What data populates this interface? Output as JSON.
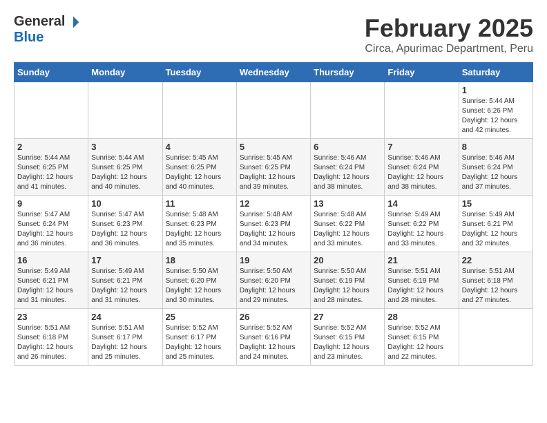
{
  "header": {
    "logo_general": "General",
    "logo_blue": "Blue",
    "title": "February 2025",
    "subtitle": "Circa, Apurimac Department, Peru"
  },
  "days_of_week": [
    "Sunday",
    "Monday",
    "Tuesday",
    "Wednesday",
    "Thursday",
    "Friday",
    "Saturday"
  ],
  "weeks": [
    [
      {
        "day": "",
        "info": ""
      },
      {
        "day": "",
        "info": ""
      },
      {
        "day": "",
        "info": ""
      },
      {
        "day": "",
        "info": ""
      },
      {
        "day": "",
        "info": ""
      },
      {
        "day": "",
        "info": ""
      },
      {
        "day": "1",
        "info": "Sunrise: 5:44 AM\nSunset: 6:26 PM\nDaylight: 12 hours\nand 42 minutes."
      }
    ],
    [
      {
        "day": "2",
        "info": "Sunrise: 5:44 AM\nSunset: 6:25 PM\nDaylight: 12 hours\nand 41 minutes."
      },
      {
        "day": "3",
        "info": "Sunrise: 5:44 AM\nSunset: 6:25 PM\nDaylight: 12 hours\nand 40 minutes."
      },
      {
        "day": "4",
        "info": "Sunrise: 5:45 AM\nSunset: 6:25 PM\nDaylight: 12 hours\nand 40 minutes."
      },
      {
        "day": "5",
        "info": "Sunrise: 5:45 AM\nSunset: 6:25 PM\nDaylight: 12 hours\nand 39 minutes."
      },
      {
        "day": "6",
        "info": "Sunrise: 5:46 AM\nSunset: 6:24 PM\nDaylight: 12 hours\nand 38 minutes."
      },
      {
        "day": "7",
        "info": "Sunrise: 5:46 AM\nSunset: 6:24 PM\nDaylight: 12 hours\nand 38 minutes."
      },
      {
        "day": "8",
        "info": "Sunrise: 5:46 AM\nSunset: 6:24 PM\nDaylight: 12 hours\nand 37 minutes."
      }
    ],
    [
      {
        "day": "9",
        "info": "Sunrise: 5:47 AM\nSunset: 6:24 PM\nDaylight: 12 hours\nand 36 minutes."
      },
      {
        "day": "10",
        "info": "Sunrise: 5:47 AM\nSunset: 6:23 PM\nDaylight: 12 hours\nand 36 minutes."
      },
      {
        "day": "11",
        "info": "Sunrise: 5:48 AM\nSunset: 6:23 PM\nDaylight: 12 hours\nand 35 minutes."
      },
      {
        "day": "12",
        "info": "Sunrise: 5:48 AM\nSunset: 6:23 PM\nDaylight: 12 hours\nand 34 minutes."
      },
      {
        "day": "13",
        "info": "Sunrise: 5:48 AM\nSunset: 6:22 PM\nDaylight: 12 hours\nand 33 minutes."
      },
      {
        "day": "14",
        "info": "Sunrise: 5:49 AM\nSunset: 6:22 PM\nDaylight: 12 hours\nand 33 minutes."
      },
      {
        "day": "15",
        "info": "Sunrise: 5:49 AM\nSunset: 6:21 PM\nDaylight: 12 hours\nand 32 minutes."
      }
    ],
    [
      {
        "day": "16",
        "info": "Sunrise: 5:49 AM\nSunset: 6:21 PM\nDaylight: 12 hours\nand 31 minutes."
      },
      {
        "day": "17",
        "info": "Sunrise: 5:49 AM\nSunset: 6:21 PM\nDaylight: 12 hours\nand 31 minutes."
      },
      {
        "day": "18",
        "info": "Sunrise: 5:50 AM\nSunset: 6:20 PM\nDaylight: 12 hours\nand 30 minutes."
      },
      {
        "day": "19",
        "info": "Sunrise: 5:50 AM\nSunset: 6:20 PM\nDaylight: 12 hours\nand 29 minutes."
      },
      {
        "day": "20",
        "info": "Sunrise: 5:50 AM\nSunset: 6:19 PM\nDaylight: 12 hours\nand 28 minutes."
      },
      {
        "day": "21",
        "info": "Sunrise: 5:51 AM\nSunset: 6:19 PM\nDaylight: 12 hours\nand 28 minutes."
      },
      {
        "day": "22",
        "info": "Sunrise: 5:51 AM\nSunset: 6:18 PM\nDaylight: 12 hours\nand 27 minutes."
      }
    ],
    [
      {
        "day": "23",
        "info": "Sunrise: 5:51 AM\nSunset: 6:18 PM\nDaylight: 12 hours\nand 26 minutes."
      },
      {
        "day": "24",
        "info": "Sunrise: 5:51 AM\nSunset: 6:17 PM\nDaylight: 12 hours\nand 25 minutes."
      },
      {
        "day": "25",
        "info": "Sunrise: 5:52 AM\nSunset: 6:17 PM\nDaylight: 12 hours\nand 25 minutes."
      },
      {
        "day": "26",
        "info": "Sunrise: 5:52 AM\nSunset: 6:16 PM\nDaylight: 12 hours\nand 24 minutes."
      },
      {
        "day": "27",
        "info": "Sunrise: 5:52 AM\nSunset: 6:15 PM\nDaylight: 12 hours\nand 23 minutes."
      },
      {
        "day": "28",
        "info": "Sunrise: 5:52 AM\nSunset: 6:15 PM\nDaylight: 12 hours\nand 22 minutes."
      },
      {
        "day": "",
        "info": ""
      }
    ]
  ]
}
